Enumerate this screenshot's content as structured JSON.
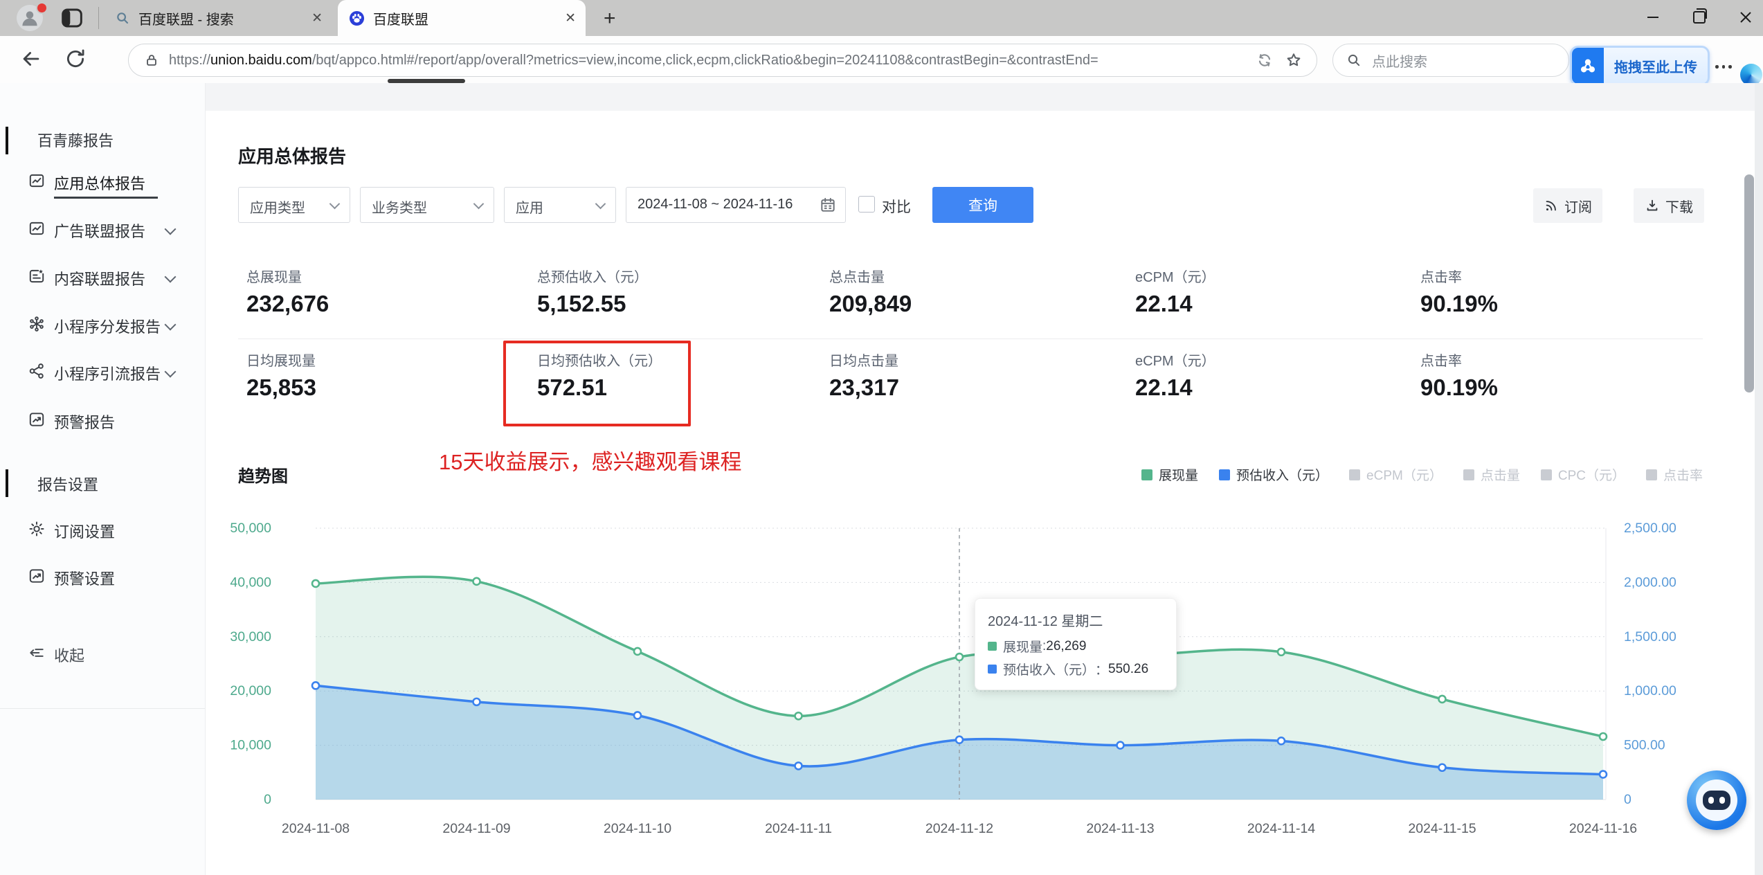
{
  "titlebar": {
    "tabs": [
      {
        "title": "百度联盟 - 搜索"
      },
      {
        "title": "百度联盟"
      }
    ]
  },
  "toolbar": {
    "url_scheme": "https://",
    "url_domain": "union.baidu.com",
    "url_path": "/bqt/appco.html#/report/app/overall?metrics=view,income,click,ecpm,clickRatio&begin=20241108&contrastBegin=&contrastEnd=",
    "search_placeholder": "点此搜索",
    "upload_label": "拖拽至此上传"
  },
  "sidebar": {
    "section_reports": "百青藤报告",
    "items": [
      {
        "label": "应用总体报告",
        "active": true,
        "expandable": false
      },
      {
        "label": "广告联盟报告",
        "active": false,
        "expandable": true
      },
      {
        "label": "内容联盟报告",
        "active": false,
        "expandable": true
      },
      {
        "label": "小程序分发报告",
        "active": false,
        "expandable": true
      },
      {
        "label": "小程序引流报告",
        "active": false,
        "expandable": true
      },
      {
        "label": "预警报告",
        "active": false,
        "expandable": false
      }
    ],
    "section_settings": "报告设置",
    "settings_items": [
      {
        "label": "订阅设置"
      },
      {
        "label": "预警设置"
      }
    ],
    "collapse_label": "收起"
  },
  "main": {
    "page_title": "应用总体报告",
    "filters": {
      "app_type": "应用类型",
      "business_type": "业务类型",
      "app": "应用",
      "date_range": "2024-11-08 ~ 2024-11-16",
      "compare_label": "对比",
      "query_button": "查询",
      "subscribe_button": "订阅",
      "download_button": "下载"
    },
    "stats": {
      "row1": [
        {
          "label": "总展现量",
          "value": "232,676"
        },
        {
          "label": "总预估收入（元）",
          "value": "5,152.55"
        },
        {
          "label": "总点击量",
          "value": "209,849"
        },
        {
          "label": "eCPM（元）",
          "value": "22.14"
        },
        {
          "label": "点击率",
          "value": "90.19%"
        }
      ],
      "row2": [
        {
          "label": "日均展现量",
          "value": "25,853"
        },
        {
          "label": "日均预估收入（元）",
          "value": "572.51"
        },
        {
          "label": "日均点击量",
          "value": "23,317"
        },
        {
          "label": "eCPM（元）",
          "value": "22.14"
        },
        {
          "label": "点击率",
          "value": "90.19%"
        }
      ]
    },
    "annotation": "15天收益展示，感兴趣观看课程",
    "chart_title": "趋势图",
    "legend": [
      {
        "label": "展现量",
        "color": "#54b58c",
        "active": true
      },
      {
        "label": "预估收入（元）",
        "color": "#3a82ee",
        "active": true
      },
      {
        "label": "eCPM（元）",
        "color": "#c9ccd2",
        "active": false
      },
      {
        "label": "点击量",
        "color": "#c9ccd2",
        "active": false
      },
      {
        "label": "CPC（元）",
        "color": "#c9ccd2",
        "active": false
      },
      {
        "label": "点击率",
        "color": "#c9ccd2",
        "active": false
      }
    ],
    "tooltip": {
      "title": "2024-11-12 星期二",
      "rows": [
        {
          "label": "展现量",
          "sep": ": ",
          "value": "26,269",
          "color": "#54b58c"
        },
        {
          "label": "预估收入（元）",
          "sep": "：",
          "value": "550.26",
          "color": "#3a82ee"
        }
      ]
    }
  },
  "chart_data": {
    "type": "area",
    "x": [
      "2024-11-08",
      "2024-11-09",
      "2024-11-10",
      "2024-11-11",
      "2024-11-12",
      "2024-11-13",
      "2024-11-14",
      "2024-11-15",
      "2024-11-16"
    ],
    "series": [
      {
        "name": "展现量",
        "axis": "left",
        "color": "#54b58c",
        "fill": "rgba(84,181,140,0.16)",
        "values": [
          39800,
          40200,
          27300,
          15400,
          26269,
          26400,
          27200,
          18500,
          11607
        ]
      },
      {
        "name": "预估收入（元）",
        "axis": "right",
        "color": "#3a82ee",
        "fill": "rgba(120,178,232,0.42)",
        "values": [
          1050,
          900,
          775,
          310,
          550.26,
          500,
          540,
          295,
          232.29
        ]
      }
    ],
    "left_axis": {
      "min": 0,
      "max": 50000,
      "tick_labels": [
        "0",
        "10,000",
        "20,000",
        "30,000",
        "40,000",
        "50,000"
      ],
      "color": "#4da98c"
    },
    "right_axis": {
      "min": 0,
      "max": 2500,
      "tick_labels": [
        "0",
        "500.00",
        "1,000.00",
        "1,500.00",
        "2,000.00",
        "2,500.00"
      ],
      "color": "#5b9bd8"
    },
    "x_label_color": "#5c6066",
    "grid": "dotted-horizontal",
    "legend_position": "top-right",
    "highlight_index": 4
  }
}
